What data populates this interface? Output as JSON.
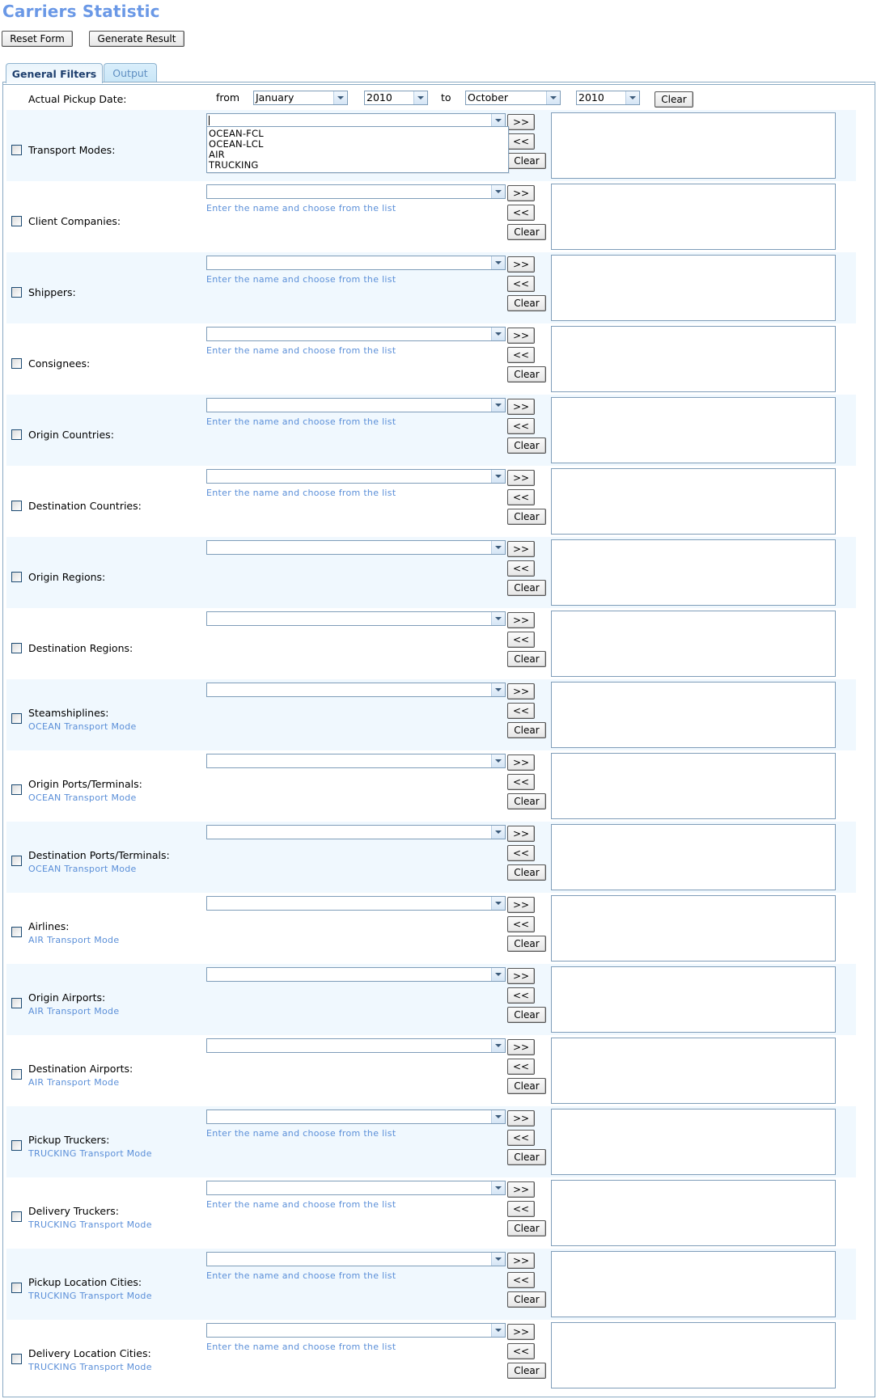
{
  "title": "Carriers Statistic",
  "toolbar": {
    "reset_label": "Reset Form",
    "generate_label": "Generate Result"
  },
  "tabs": [
    {
      "label": "General Filters",
      "active": true
    },
    {
      "label": "Output",
      "active": false
    }
  ],
  "date_filter": {
    "label": "Actual Pickup Date:",
    "from_word": "from",
    "to_word": "to",
    "from_month": "January",
    "from_year": "2010",
    "to_month": "October",
    "to_year": "2010",
    "clear_label": "Clear"
  },
  "buttons": {
    "add": ">>",
    "remove": "<<",
    "clear": "Clear"
  },
  "hint_text": "Enter the name and choose from the list",
  "transport_dropdown": {
    "options": [
      "OCEAN-FCL",
      "OCEAN-LCL",
      "AIR",
      "TRUCKING"
    ]
  },
  "filters": [
    {
      "label": "Transport Modes:",
      "sub": "",
      "hint": false,
      "checked": false
    },
    {
      "label": "Client Companies:",
      "sub": "",
      "hint": true,
      "checked": false
    },
    {
      "label": "Shippers:",
      "sub": "",
      "hint": true,
      "checked": false
    },
    {
      "label": "Consignees:",
      "sub": "",
      "hint": true,
      "checked": false
    },
    {
      "label": "Origin Countries:",
      "sub": "",
      "hint": true,
      "checked": false
    },
    {
      "label": "Destination Countries:",
      "sub": "",
      "hint": true,
      "checked": false
    },
    {
      "label": "Origin Regions:",
      "sub": "",
      "hint": false,
      "checked": false
    },
    {
      "label": "Destination Regions:",
      "sub": "",
      "hint": false,
      "checked": false
    },
    {
      "label": "Steamshiplines:",
      "sub": "OCEAN Transport Mode",
      "hint": false,
      "checked": false
    },
    {
      "label": "Origin Ports/Terminals:",
      "sub": "OCEAN Transport Mode",
      "hint": false,
      "checked": false
    },
    {
      "label": "Destination Ports/Terminals:",
      "sub": "OCEAN Transport Mode",
      "hint": false,
      "checked": false
    },
    {
      "label": "Airlines:",
      "sub": "AIR Transport Mode",
      "hint": false,
      "checked": false
    },
    {
      "label": "Origin Airports:",
      "sub": "AIR Transport Mode",
      "hint": false,
      "checked": false
    },
    {
      "label": "Destination Airports:",
      "sub": "AIR Transport Mode",
      "hint": false,
      "checked": false
    },
    {
      "label": "Pickup Truckers:",
      "sub": "TRUCKING Transport Mode",
      "hint": true,
      "checked": false
    },
    {
      "label": "Delivery Truckers:",
      "sub": "TRUCKING Transport Mode",
      "hint": true,
      "checked": false
    },
    {
      "label": "Pickup Location Cities:",
      "sub": "TRUCKING Transport Mode",
      "hint": true,
      "checked": false
    },
    {
      "label": "Delivery Location Cities:",
      "sub": "TRUCKING Transport Mode",
      "hint": true,
      "checked": false
    }
  ],
  "colors": {
    "title": "#6a98e6",
    "hint": "#5b8fd8",
    "stripe": "#f0f8fe",
    "border": "#7f9db9"
  }
}
